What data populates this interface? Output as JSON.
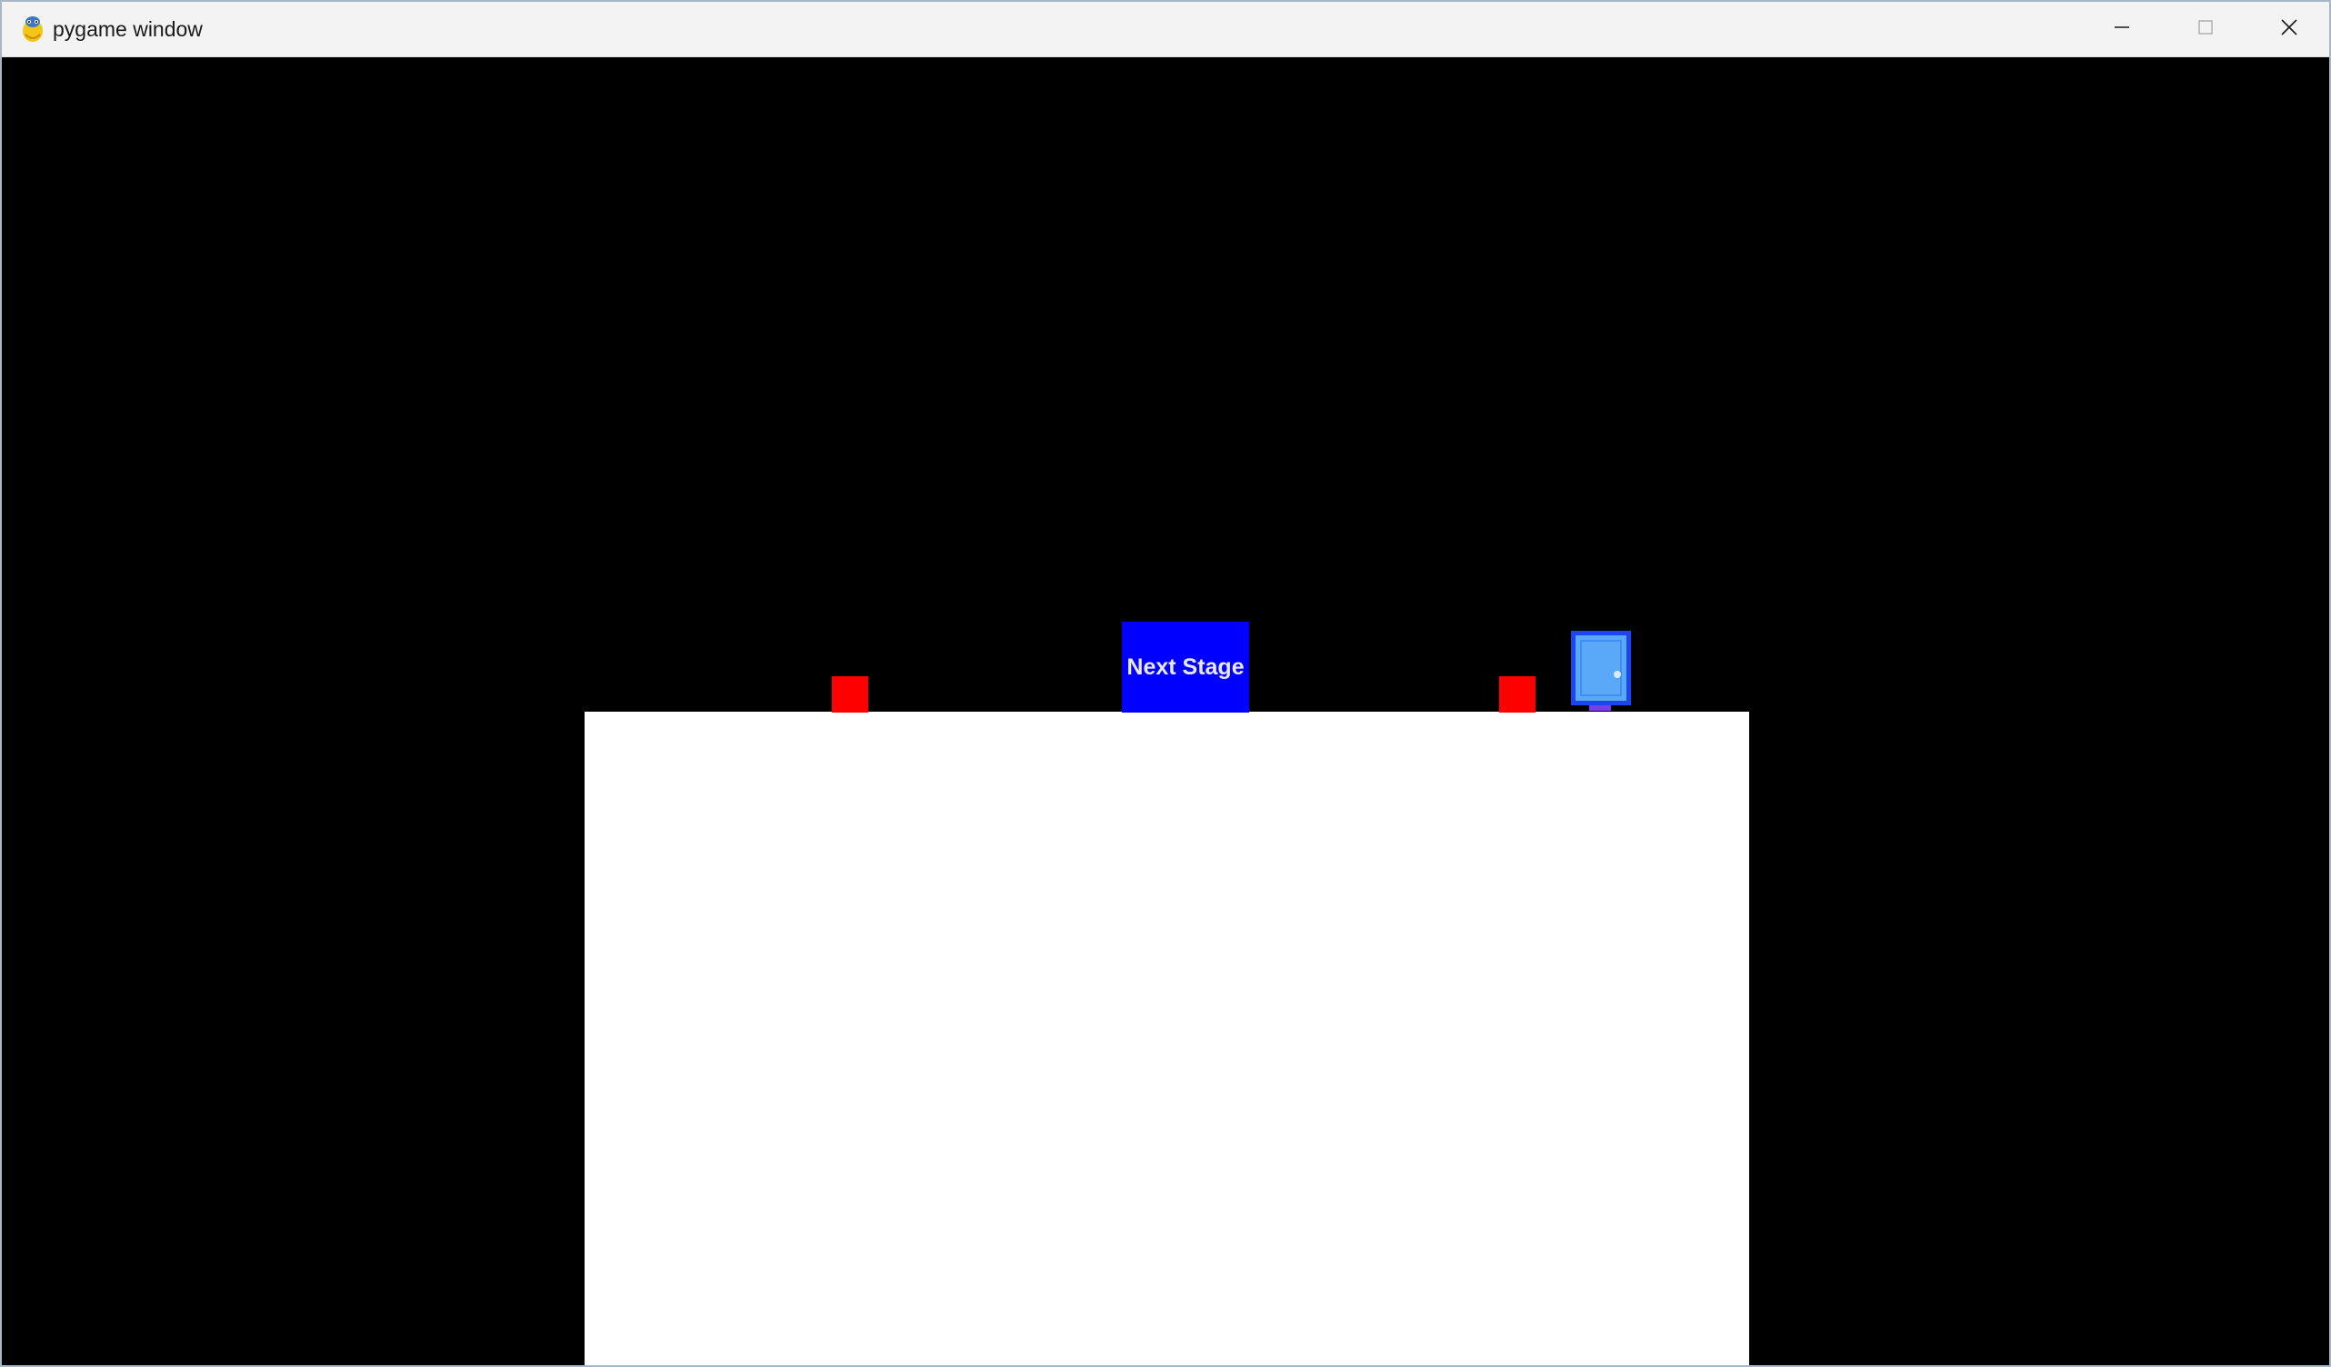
{
  "window": {
    "title": "pygame window"
  },
  "caption_buttons": {
    "minimize_icon": "minimize-icon",
    "maximize_icon": "maximize-icon",
    "close_icon": "close-icon"
  },
  "game": {
    "background_color": "#000000",
    "ground_color": "#ffffff",
    "spike_color": "#ff0000",
    "next_stage": {
      "label": "Next Stage",
      "color": "#0000ff"
    },
    "door": {
      "frame_color": "#1b45f0",
      "panel_color": "#5aa8f8",
      "icon": "door-icon"
    }
  }
}
